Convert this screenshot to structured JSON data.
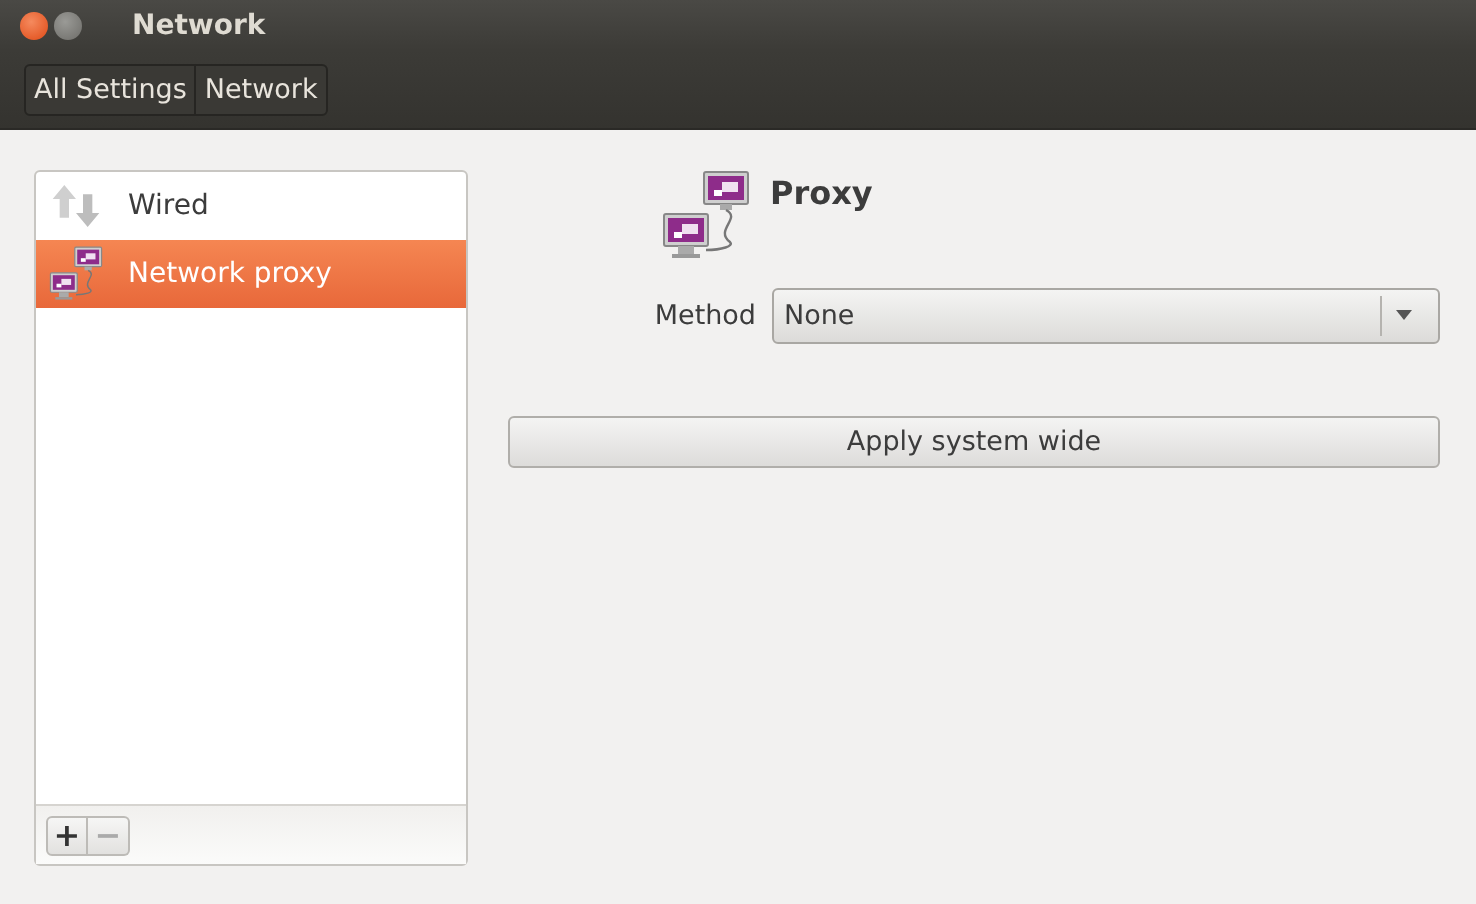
{
  "window": {
    "title": "Network"
  },
  "breadcrumbs": [
    {
      "label": "All Settings"
    },
    {
      "label": "Network"
    }
  ],
  "sidebar": {
    "items": [
      {
        "kind": "wired",
        "label": "Wired",
        "selected": false
      },
      {
        "kind": "proxy",
        "label": "Network proxy",
        "selected": true
      }
    ],
    "toolbar": [
      {
        "label": "+",
        "disabled": false
      },
      {
        "label": "−",
        "disabled": true
      }
    ]
  },
  "panel": {
    "title": "Proxy",
    "method_label": "Method",
    "method_value": "None",
    "apply_button": "Apply system wide"
  }
}
